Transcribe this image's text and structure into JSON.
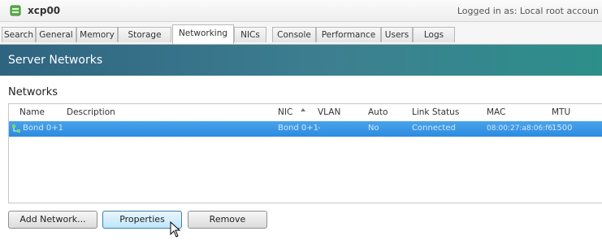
{
  "title_bar": {
    "host_name": "xcp00",
    "logged_in": "Logged in as: Local root accoun"
  },
  "tabs": [
    {
      "label": "Search",
      "active": false
    },
    {
      "label": "General",
      "active": false
    },
    {
      "label": "Memory",
      "active": false
    },
    {
      "label": "Storage",
      "active": false
    },
    {
      "label": "Networking",
      "active": true
    },
    {
      "label": "NICs",
      "active": false
    },
    {
      "label": "Console",
      "active": false
    },
    {
      "label": "Performance",
      "active": false
    },
    {
      "label": "Users",
      "active": false
    },
    {
      "label": "Logs",
      "active": false
    }
  ],
  "banner": {
    "title": "Server Networks"
  },
  "networks": {
    "section_title": "Networks",
    "columns": {
      "name": "Name",
      "description": "Description",
      "nic": "NIC",
      "vlan": "VLAN",
      "auto": "Auto",
      "link_status": "Link Status",
      "mac": "MAC",
      "mtu": "MTU"
    },
    "sorted_column": "NIC",
    "rows": [
      {
        "name": "Bond 0+1",
        "description": "",
        "nic": "Bond 0+1",
        "vlan": "-",
        "auto": "No",
        "link_status": "Connected",
        "mac": "08:00:27:a8:06:f6",
        "mtu": "1500",
        "selected": true
      }
    ]
  },
  "buttons": {
    "add_network": "Add Network...",
    "properties": "Properties",
    "remove": "Remove"
  },
  "colors": {
    "banner_start": "#2f6480",
    "banner_end": "#2c8f8a",
    "selection": "#2b8be0"
  },
  "icons": {
    "host": "server-green-icon",
    "network_row": "network-icon",
    "sort": "sort-ascending-icon",
    "pointer": "mouse-cursor-icon"
  }
}
